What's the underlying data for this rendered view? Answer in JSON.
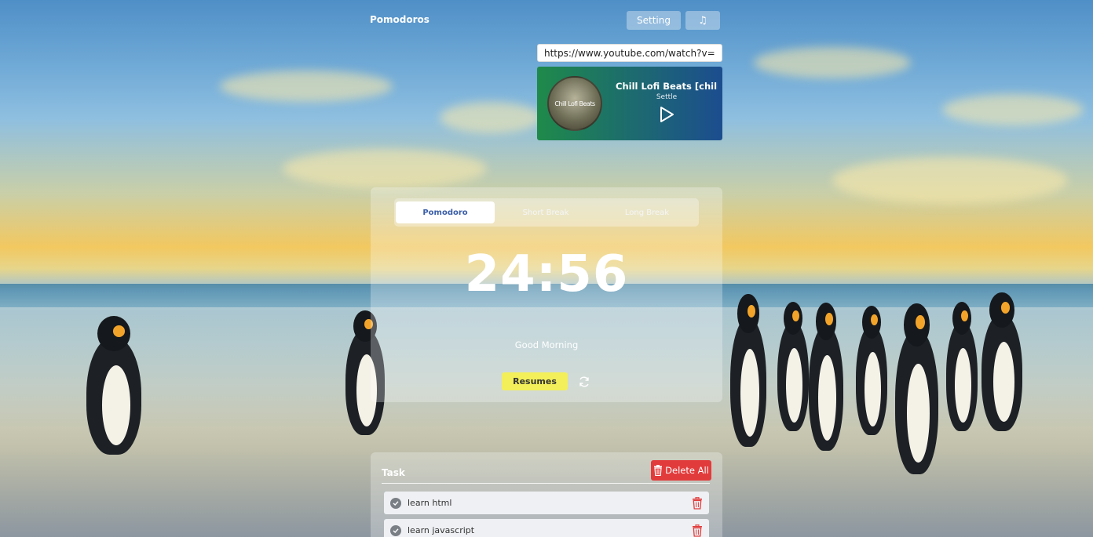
{
  "header": {
    "app_title": "Pomodoros",
    "setting_label": "Setting",
    "music_icon": "music-note-icon"
  },
  "music": {
    "url_value": "https://www.youtube.com/watch?v=Np(",
    "album_text": "Chill Lofi Beats",
    "song_title": "Chill Lofi Beats [chill lo",
    "artist": "Settle"
  },
  "timer": {
    "tabs": [
      {
        "label": "Pomodoro",
        "active": true
      },
      {
        "label": "Short Break",
        "active": false
      },
      {
        "label": "Long Break",
        "active": false
      }
    ],
    "time": "24:56",
    "greeting": "Good Morning",
    "resume_label": "Resumes",
    "reset_icon": "refresh-icon"
  },
  "tasks": {
    "heading": "Task",
    "delete_all_label": "Delete All",
    "items": [
      {
        "label": "learn html"
      },
      {
        "label": "learn javascript"
      }
    ]
  },
  "colors": {
    "accent_tab_text": "#3b5fa8",
    "resume_button": "#f2ef5a",
    "delete_button": "#e23b3b"
  }
}
